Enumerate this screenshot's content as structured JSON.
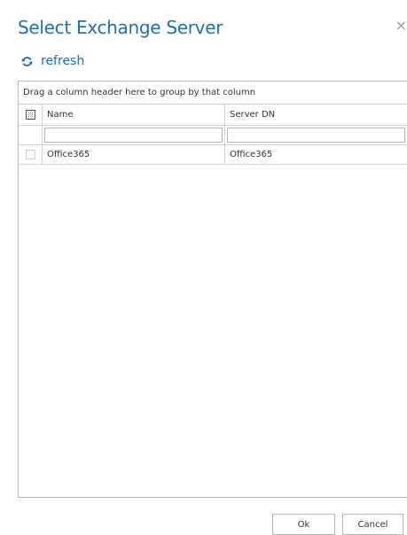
{
  "dialog": {
    "title": "Select Exchange Server",
    "close_glyph": "×"
  },
  "toolbar": {
    "refresh_label": "refresh",
    "refresh_icon": "refresh-icon",
    "accent": "#1f6fb4"
  },
  "grid": {
    "group_panel_text": "Drag a column header here to group by that column",
    "columns": [
      "Name",
      "Server DN"
    ],
    "filters": [
      "",
      ""
    ],
    "rows": [
      {
        "checked": false,
        "name": "Office365",
        "server_dn": "Office365"
      }
    ]
  },
  "footer": {
    "ok_label": "Ok",
    "cancel_label": "Cancel"
  }
}
